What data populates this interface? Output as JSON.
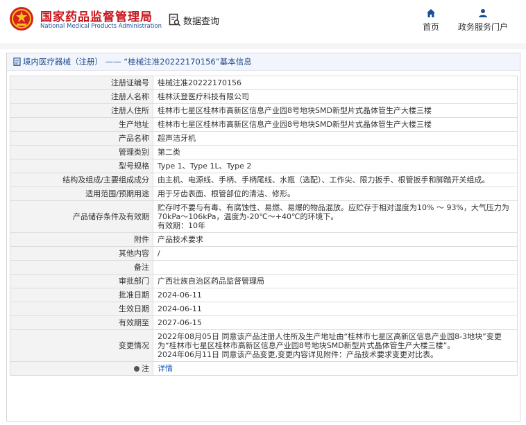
{
  "header": {
    "logo_cn": "国家药品监督管理局",
    "logo_en": "National Medical Products Administration",
    "data_query": "数据查询",
    "nav": [
      {
        "label": "首页",
        "icon": "home-icon"
      },
      {
        "label": "政务服务门户",
        "icon": "user-icon"
      }
    ]
  },
  "panel": {
    "title": "境内医疗器械（注册） —— “桂械注准20222170156”基本信息"
  },
  "rows": [
    {
      "key": "注册证编号",
      "value": "桂械注准20222170156"
    },
    {
      "key": "注册人名称",
      "value": "桂林沃登医疗科技有限公司"
    },
    {
      "key": "注册人住所",
      "value": "桂林市七星区桂林市高新区信息产业园8号地块SMD新型片式晶体管生产大楼三楼"
    },
    {
      "key": "生产地址",
      "value": "桂林市七星区桂林市高新区信息产业园8号地块SMD新型片式晶体管生产大楼三楼"
    },
    {
      "key": "产品名称",
      "value": "超声洁牙机"
    },
    {
      "key": "管理类别",
      "value": "第二类"
    },
    {
      "key": "型号规格",
      "value": "Type 1、Type 1L、Type 2"
    },
    {
      "key": "结构及组成/主要组成成分",
      "value": "由主机、电源线、手柄、手柄尾线、水瓶（选配）、工作尖、限力扳手、根管扳手和脚踏开关组成。"
    },
    {
      "key": "适用范围/预期用途",
      "value": "用于牙齿表面、根管部位的清洁、修形。"
    },
    {
      "key": "产品储存条件及有效期",
      "value": "贮存时不要与有毒、有腐蚀性、易燃、易爆的物品混放。应贮存于相对湿度为10% ～ 93%，大气压力为70kPa～106kPa，温度为-20℃～+40℃的环境下。",
      "value2": "有效期：10年"
    },
    {
      "key": "附件",
      "value": "产品技术要求"
    },
    {
      "key": "其他内容",
      "value": "/"
    },
    {
      "key": "备注",
      "value": ""
    },
    {
      "key": "审批部门",
      "value": "广西壮族自治区药品监督管理局"
    },
    {
      "key": "批准日期",
      "value": "2024-06-11"
    },
    {
      "key": "生效日期",
      "value": "2024-06-11"
    },
    {
      "key": "有效期至",
      "value": "2027-06-15"
    },
    {
      "key": "变更情况",
      "value": "2022年08月05日 同意该产品注册人住所及生产地址由“桂林市七星区高新区信息产业园8-3地块”变更为“桂林市七星区桂林市高新区信息产业园8号地块SMD新型片式晶体管生产大楼三楼”。",
      "value2": "2024年06月11日 同意该产品变更,变更内容详见附件：产品技术要求变更对比表。"
    },
    {
      "key": "注",
      "value": "详情"
    }
  ]
}
